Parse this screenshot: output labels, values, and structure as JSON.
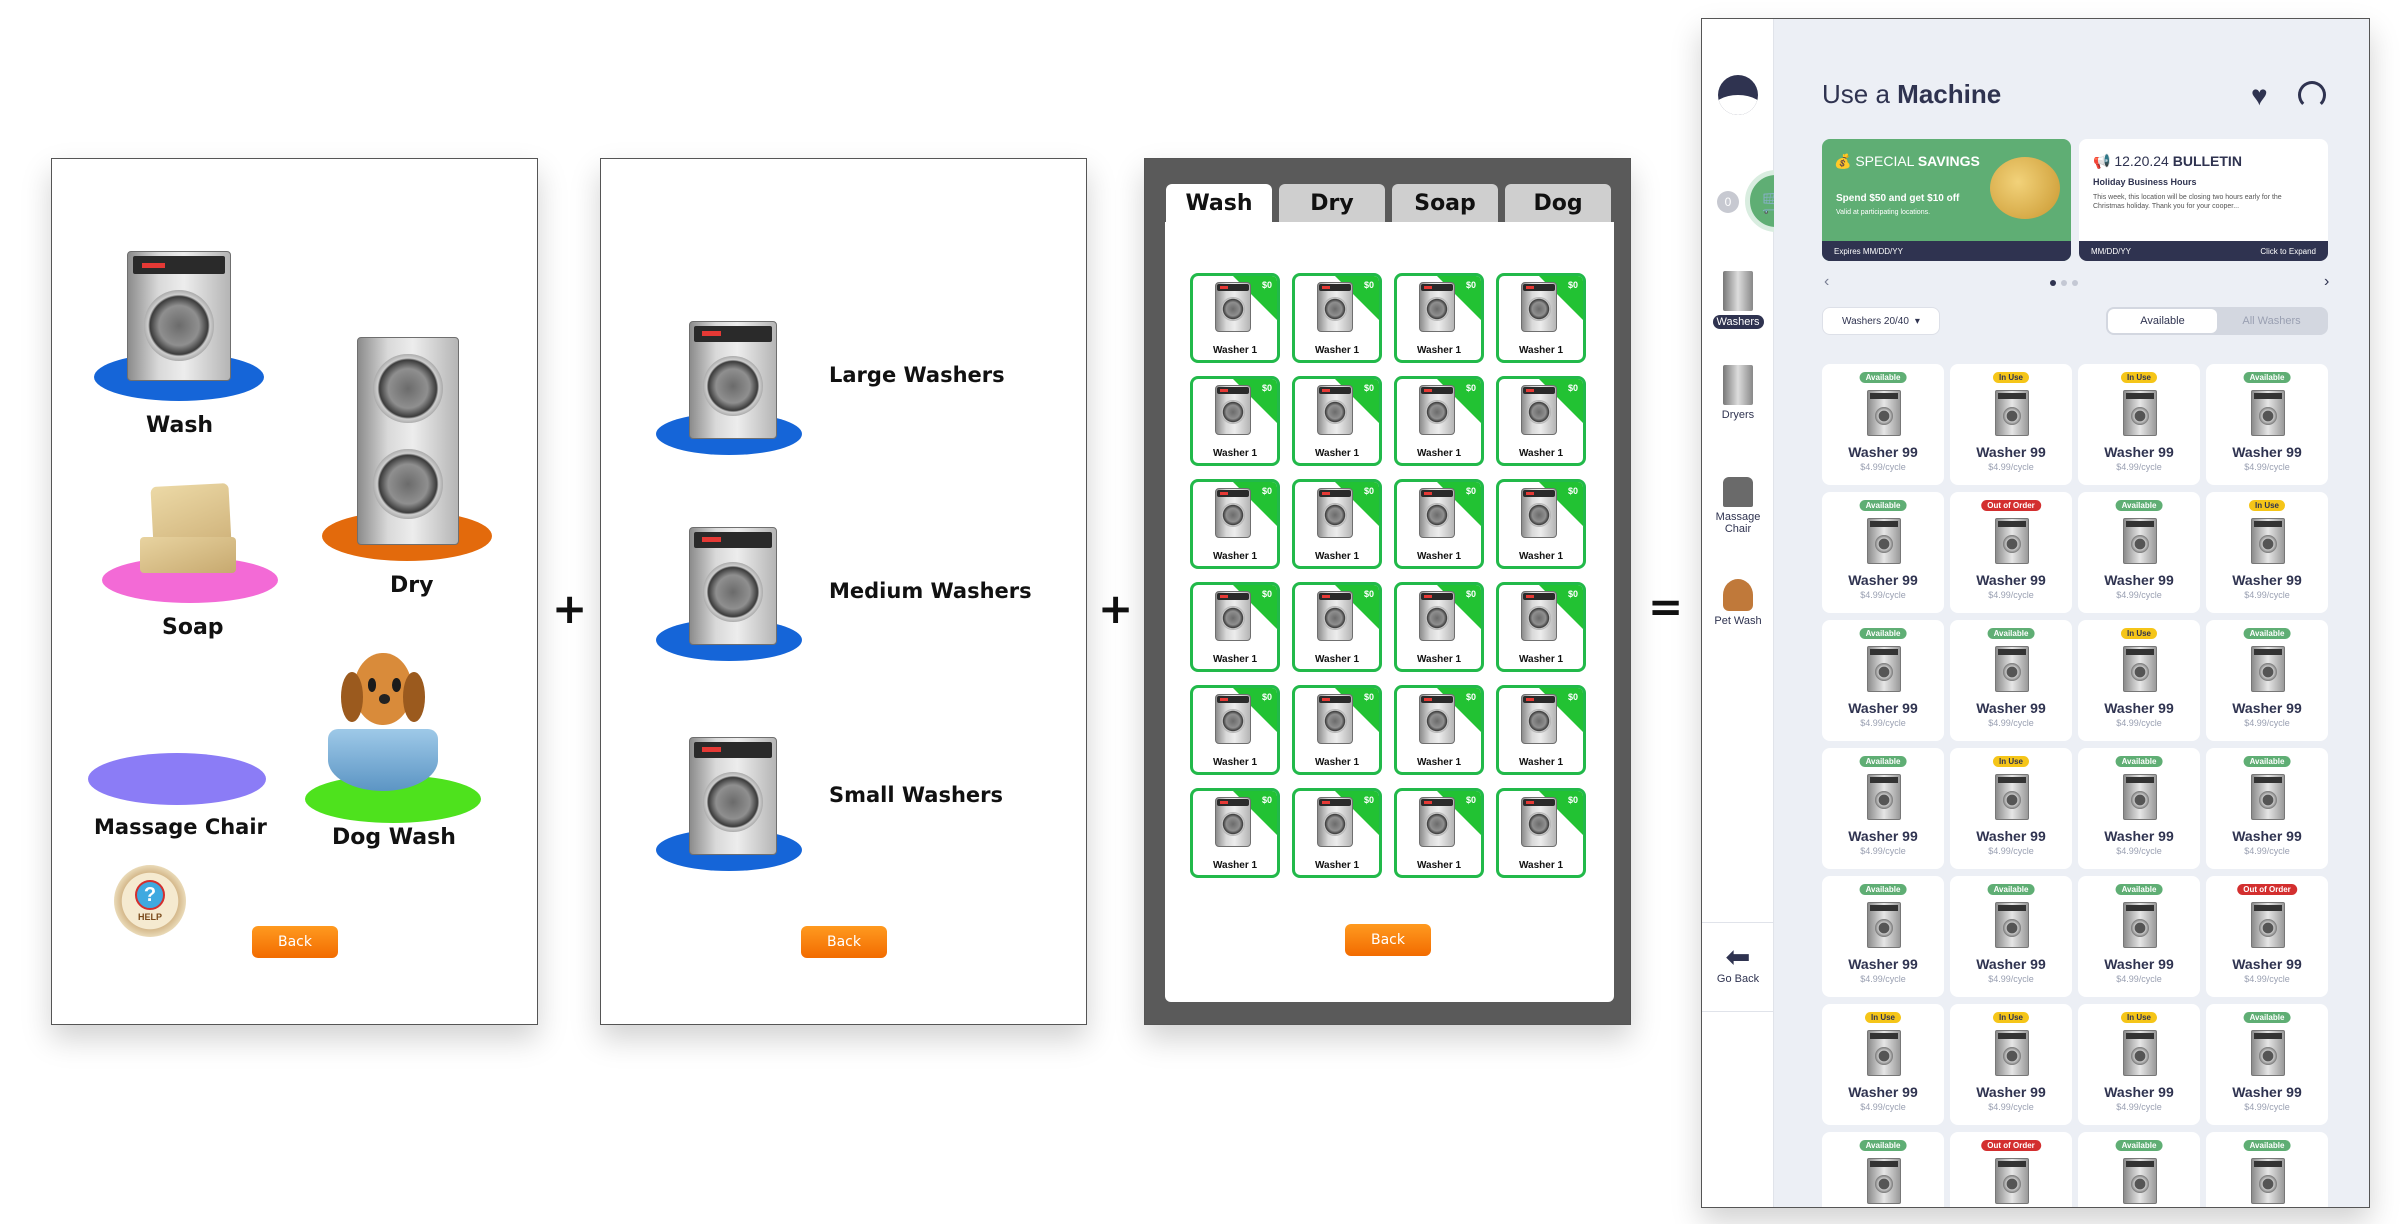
{
  "panel1": {
    "labels": {
      "wash": "Wash",
      "dry": "Dry",
      "soap": "Soap",
      "massage": "Massage Chair",
      "dog": "Dog Wash"
    },
    "help_text": "HELP",
    "back": "Back"
  },
  "operators": {
    "plus": "+",
    "equals": "="
  },
  "panel2": {
    "items": [
      "Large Washers",
      "Medium Washers",
      "Small Washers"
    ],
    "back": "Back"
  },
  "panel3": {
    "tabs": [
      "Wash",
      "Dry",
      "Soap",
      "Dog"
    ],
    "card_label": "Washer 1",
    "card_price": "$0",
    "rows": 6,
    "cols": 4,
    "back": "Back"
  },
  "panel4": {
    "title_prefix": "Use a ",
    "title_bold": "Machine",
    "cart_count": "0",
    "sidebar": [
      "Washers",
      "Dryers",
      "Massage Chair",
      "Pet Wash"
    ],
    "go_back": "Go Back",
    "promo": {
      "title_light": "SPECIAL ",
      "title_bold": "SAVINGS",
      "line1": "Spend $50 and get $10 off",
      "line2": "Valid at participating locations.",
      "foot": "Expires MM/DD/YY"
    },
    "bulletin": {
      "date": "12.20.24",
      "title": "BULLETIN",
      "subtitle": "Holiday Business Hours",
      "body": "This week, this location will be closing two hours early for the Christmas holiday. Thank you for your cooper...",
      "foot_left": "MM/DD/YY",
      "foot_right": "Click to Expand"
    },
    "dropdown": "Washers 20/40",
    "toggle": [
      "Available",
      "All Washers"
    ],
    "machine_name": "Washer 99",
    "machine_price": "$4.99/cycle",
    "statuses": [
      [
        "Available",
        "In Use",
        "In Use",
        "Available"
      ],
      [
        "Available",
        "Out of Order",
        "Available",
        "In Use"
      ],
      [
        "Available",
        "Available",
        "In Use",
        "Available"
      ],
      [
        "Available",
        "In Use",
        "Available",
        "Available"
      ],
      [
        "Available",
        "Available",
        "Available",
        "Out of Order"
      ],
      [
        "In Use",
        "In Use",
        "In Use",
        "Available"
      ],
      [
        "Available",
        "Out of Order",
        "Available",
        "Available"
      ]
    ]
  }
}
